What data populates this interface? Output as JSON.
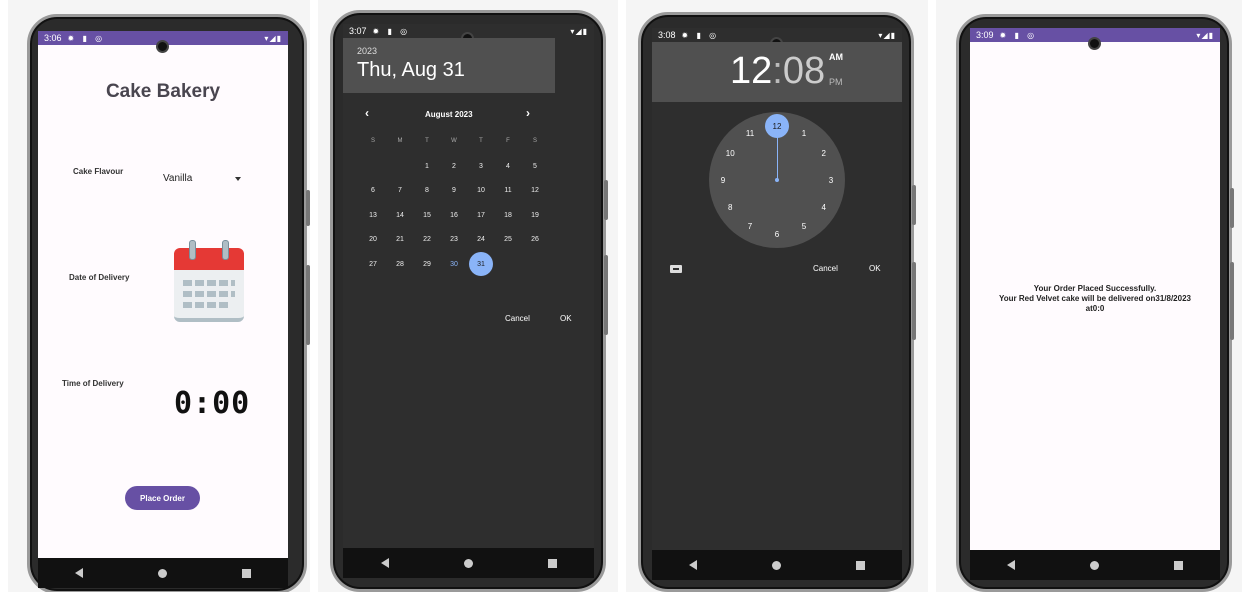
{
  "screen1": {
    "status": {
      "time": "3:06",
      "icons": "✹ ▮ ◎",
      "right": "▾◢▮"
    },
    "title": "Cake Bakery",
    "flavour_label": "Cake Flavour",
    "flavour_value": "Vanilla",
    "date_label": "Date of Delivery",
    "time_label": "Time of Delivery",
    "time_value": "0:00",
    "place_order": "Place Order",
    "icons": [
      "calendar-icon",
      "digital-clock-icon",
      "dropdown-caret-icon"
    ],
    "colors": {
      "accent": "#6750a4",
      "status_bar": "#6750a4",
      "background": "#fffbfe"
    }
  },
  "screen2": {
    "status": {
      "time": "3:07",
      "icons": "✹ ▮ ◎",
      "right": "▾◢▮"
    },
    "year": "2023",
    "date": "Thu, Aug 31",
    "month": "August 2023",
    "prev": "‹",
    "next": "›",
    "weekdays": [
      "S",
      "M",
      "T",
      "W",
      "T",
      "F",
      "S"
    ],
    "days": [
      "1",
      "2",
      "3",
      "4",
      "5",
      "6",
      "7",
      "8",
      "9",
      "10",
      "11",
      "12",
      "13",
      "14",
      "15",
      "16",
      "17",
      "18",
      "19",
      "20",
      "21",
      "22",
      "23",
      "24",
      "25",
      "26",
      "27",
      "28",
      "29",
      "30",
      "31"
    ],
    "selected_day": "31",
    "today_day": "30",
    "cancel": "Cancel",
    "ok": "OK",
    "colors": {
      "dialog": "#2e2e2e",
      "header": "#505050",
      "selected": "#8ab4f8"
    }
  },
  "screen3": {
    "status": {
      "time": "3:08",
      "icons": "✹ ▮ ◎",
      "right": "▾◢▮"
    },
    "hour": "12",
    "colon": ":",
    "minute": "08",
    "am": "AM",
    "pm": "PM",
    "clock_numbers": [
      "12",
      "1",
      "2",
      "3",
      "4",
      "5",
      "6",
      "7",
      "8",
      "9",
      "10",
      "11"
    ],
    "selected_hour": "12",
    "cancel": "Cancel",
    "ok": "OK",
    "icons": [
      "keyboard-icon"
    ]
  },
  "screen4": {
    "status": {
      "time": "3:09",
      "icons": "✹ ▮ ◎",
      "right": "▾◢▮"
    },
    "line1": "Your Order Placed Successfully.",
    "line2": "Your Red Velvet cake will be delivered on31/8/2023",
    "line3": "at0:0"
  }
}
